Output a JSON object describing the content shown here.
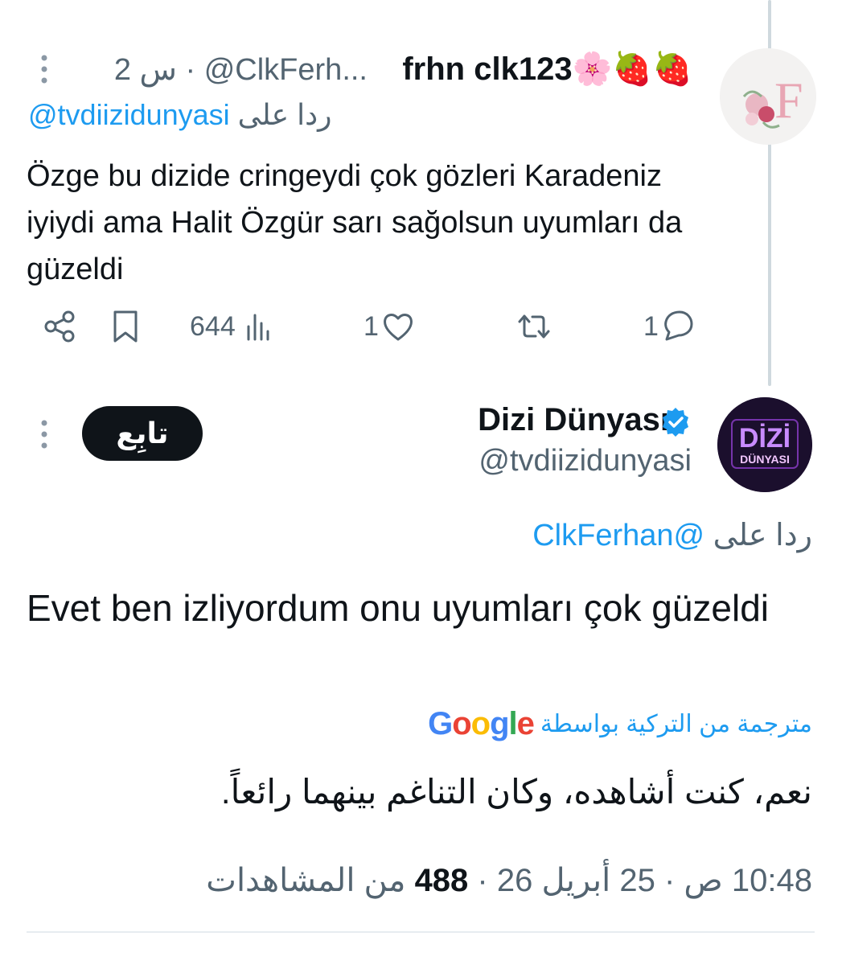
{
  "reply": {
    "author_name": "frhn clk123",
    "author_emoji": "🌸🍓🍓",
    "handle": "@ClkFerh...",
    "time": "2 س",
    "replying_to_prefix": "ردا على",
    "replying_to_handle": "@tvdiizidunyasi",
    "body": "Özge bu dizide cringeydi çok gözleri Karadeniz iyiydi ama Halit Özgür sarı sağolsun uyumları da güzeldi",
    "avatar_letter": "F",
    "actions": {
      "views": "644",
      "likes": "1",
      "replies": "1"
    }
  },
  "main": {
    "author_name": "Dizi Dünyası",
    "handle": "@tvdiizidunyasi",
    "verified": true,
    "follow_label": "تابِع",
    "avatar_text_top": "DİZİ",
    "avatar_text_bottom": "DÜNYASI",
    "replying_to_prefix": "ردا على",
    "replying_to_handle": "@ClkFerhan",
    "body": "Evet ben izliyordum onu uyumları çok güzeldi",
    "translated_by": "مترجمة من التركية بواسطة",
    "translator_brand": "Google",
    "translation": "نعم، كنت أشاهده، وكان التناغم بينهما رائعاً.",
    "time": "10:48 ص",
    "date": "25 أبريل 26",
    "views_count": "488",
    "views_label": "من المشاهدات"
  },
  "colors": {
    "link": "#1d9bf0",
    "muted": "#536471",
    "verified": "#1d9bf0",
    "follow_bg": "#0f1419"
  }
}
